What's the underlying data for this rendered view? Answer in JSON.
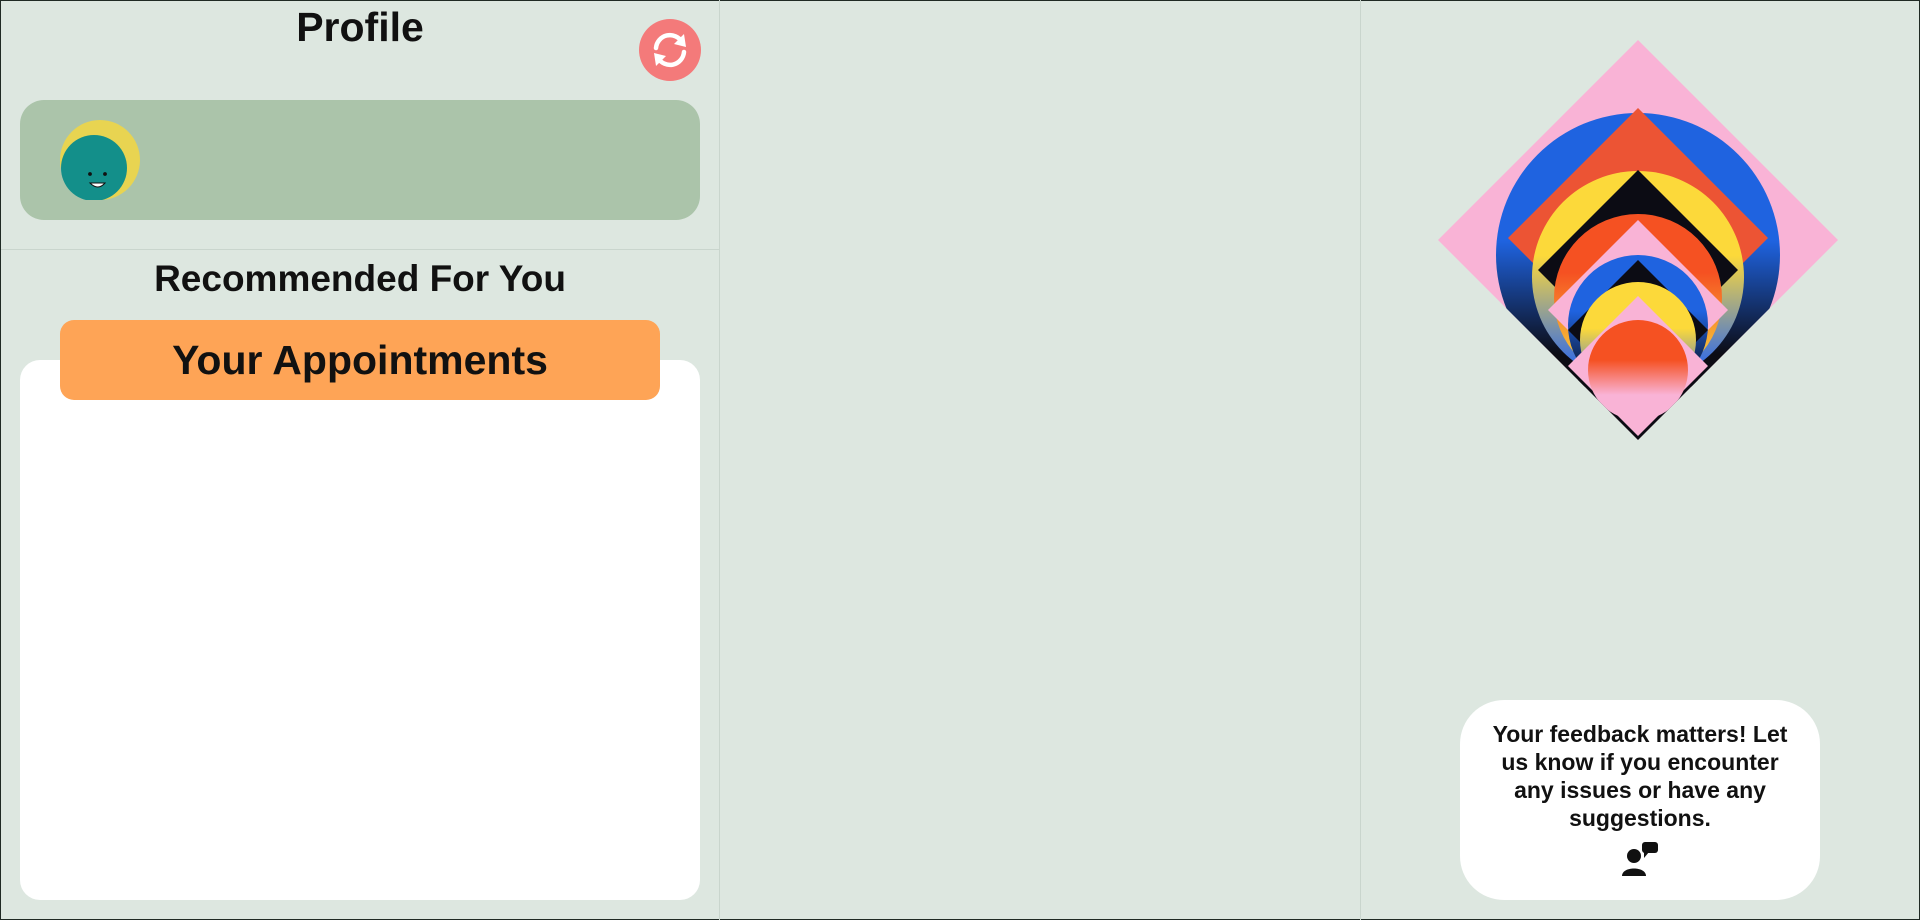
{
  "profile": {
    "title": "Profile",
    "refresh_icon": "refresh-icon",
    "avatar_icon": "smiley-avatar",
    "accent": "#f47a7a",
    "card_color": "#abc4aa"
  },
  "recommended": {
    "title": "Recommended For You"
  },
  "appointments": {
    "title": "Your Appointments",
    "header_color": "#fea456"
  },
  "art": {
    "icon": "concentric-diamond-artwork"
  },
  "feedback": {
    "text": "Your feedback matters! Let us know if you encounter any issues or have any suggestions.",
    "icon": "feedback-chat-icon"
  }
}
